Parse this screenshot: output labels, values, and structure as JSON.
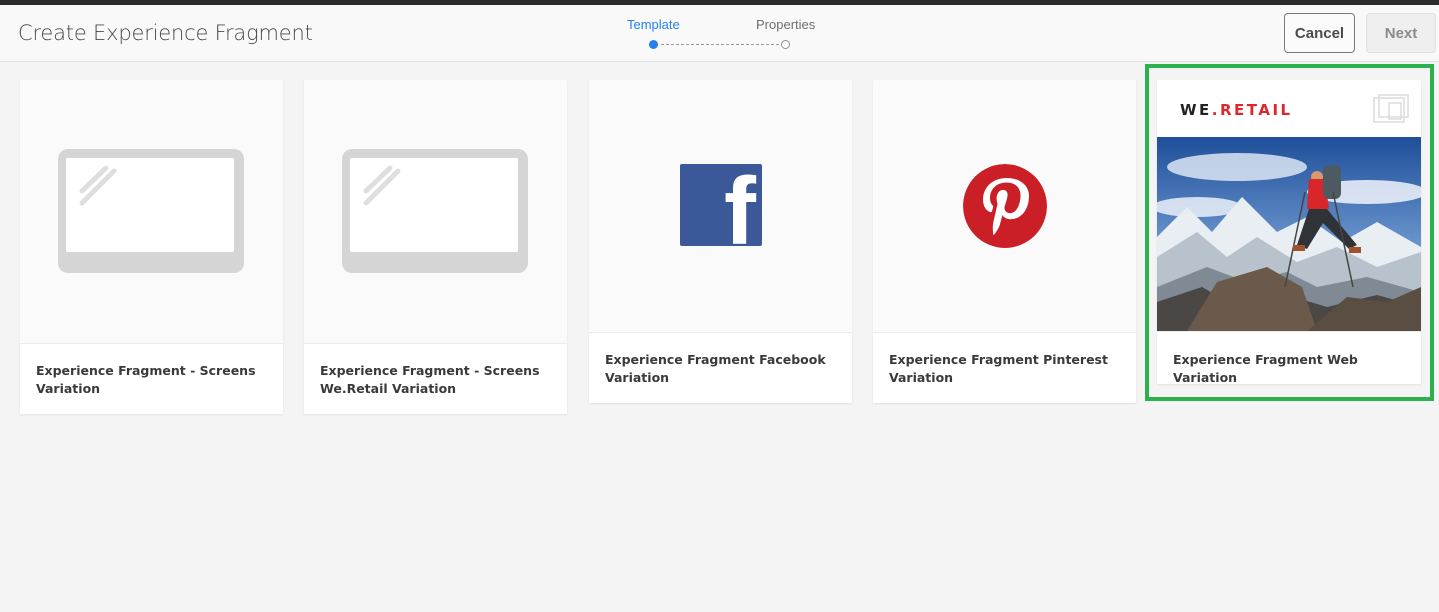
{
  "header": {
    "title": "Create Experience Fragment",
    "steps": [
      {
        "label": "Template",
        "active": true
      },
      {
        "label": "Properties",
        "active": false
      }
    ],
    "cancel_label": "Cancel",
    "next_label": "Next"
  },
  "colors": {
    "accent": "#2680eb",
    "selected_border": "#2db14f",
    "facebook": "#3b5998",
    "pinterest": "#cb1f27",
    "weretail_red": "#e0262b"
  },
  "templates": [
    {
      "label": "Experience Fragment - Screens Variation",
      "thumbnail": "screen-placeholder-icon",
      "selected": false
    },
    {
      "label": "Experience Fragment - Screens We.Retail Variation",
      "thumbnail": "screen-placeholder-icon",
      "selected": false
    },
    {
      "label": "Experience Fragment Facebook Variation",
      "thumbnail": "facebook-icon",
      "selected": false
    },
    {
      "label": "Experience Fragment Pinterest Variation",
      "thumbnail": "pinterest-icon",
      "selected": false
    },
    {
      "label": "Experience Fragment Web Variation",
      "thumbnail": "we-retail-hiker-image",
      "selected": true,
      "brand": {
        "we": "WE",
        "dot": ".",
        "retail": "RETAIL"
      }
    }
  ]
}
